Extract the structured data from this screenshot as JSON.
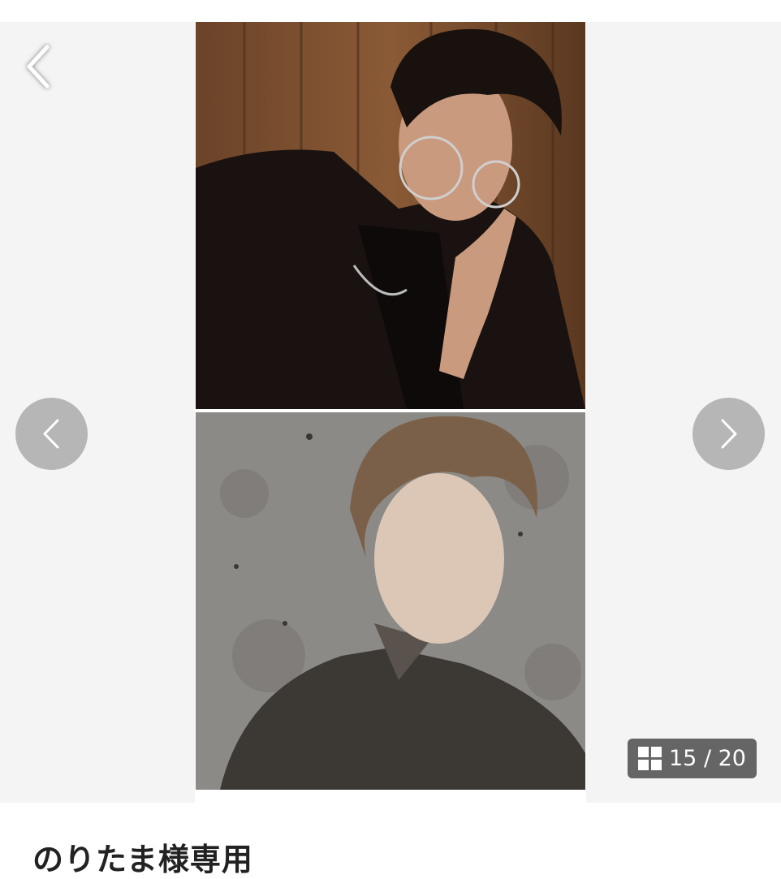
{
  "icons": {
    "back": "chevron-left-icon",
    "prev": "chevron-left-icon",
    "next": "chevron-right-icon",
    "counter": "grid-icon"
  },
  "gallery": {
    "counter": "15 / 20",
    "photos": [
      {
        "name": "portrait-top",
        "description_visible": false
      },
      {
        "name": "portrait-bottom",
        "description_visible": false
      }
    ]
  },
  "item": {
    "title": "のりたま様専用"
  },
  "colors": {
    "gallery_background": "#f4f4f4",
    "nav_circle": "#aaaaaa",
    "counter_background": "#555555"
  }
}
